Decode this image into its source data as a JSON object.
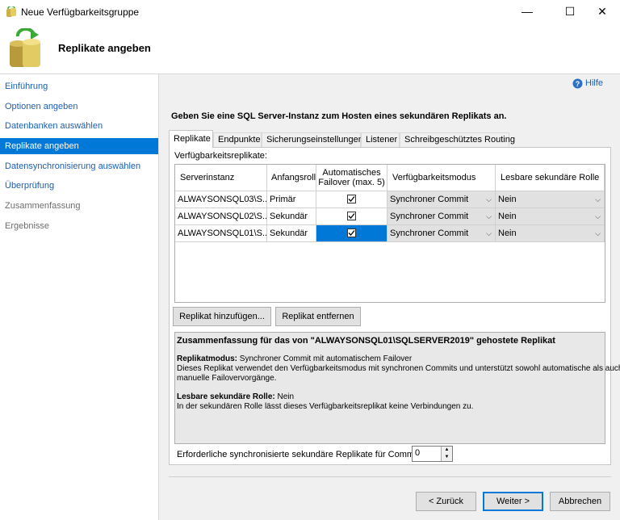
{
  "window": {
    "title": "Neue Verfügbarkeitsgruppe",
    "minimize": "—",
    "maximize": "☐",
    "close": "✕"
  },
  "header": {
    "title": "Replikate angeben"
  },
  "sidebar": {
    "items": [
      {
        "label": "Einführung",
        "state": "link"
      },
      {
        "label": "Optionen angeben",
        "state": "link"
      },
      {
        "label": "Datenbanken auswählen",
        "state": "link"
      },
      {
        "label": "Replikate angeben",
        "state": "active"
      },
      {
        "label": "Datensynchronisierung auswählen",
        "state": "link"
      },
      {
        "label": "Überprüfung",
        "state": "link"
      },
      {
        "label": "Zusammenfassung",
        "state": "disabled"
      },
      {
        "label": "Ergebnisse",
        "state": "disabled"
      }
    ]
  },
  "help": {
    "label": "Hilfe",
    "icon": "help-icon"
  },
  "main": {
    "instruction": "Geben Sie eine SQL Server-Instanz zum Hosten eines sekundären Replikats an.",
    "tabs": [
      "Replikate",
      "Endpunkte",
      "Sicherungseinstellungen",
      "Listener",
      "Schreibgeschütztes Routing"
    ],
    "active_tab": "Replikate",
    "group_label": "Verfügbarkeitsreplikate:",
    "columns": {
      "server": "Serverinstanz",
      "role": "Anfangsroll",
      "failover_1": "Automatisches",
      "failover_2": "Failover (max. 5)",
      "mode": "Verfügbarkeitsmodus",
      "readable": "Lesbare sekundäre Rolle"
    },
    "rows": [
      {
        "server": "ALWAYSONSQL03\\S...",
        "role": "Primär",
        "failover": true,
        "mode": "Synchroner Commit",
        "readable": "Nein"
      },
      {
        "server": "ALWAYSONSQL02\\S...",
        "role": "Sekundär",
        "failover": true,
        "mode": "Synchroner Commit",
        "readable": "Nein"
      },
      {
        "server": "ALWAYSONSQL01\\S...",
        "role": "Sekundär",
        "failover": true,
        "mode": "Synchroner Commit",
        "readable": "Nein"
      }
    ],
    "add_button": "Replikat hinzufügen...",
    "remove_button": "Replikat entfernen",
    "summary": {
      "title": "Zusammenfassung für das von \"ALWAYSONSQL01\\SQLSERVER2019\" gehostete Replikat",
      "mode_label": "Replikatmodus:",
      "mode_value": " Synchroner Commit mit automatischem Failover",
      "mode_desc_1": "Dieses Replikat verwendet den Verfügbarkeitsmodus mit synchronen Commits und unterstützt sowohl automatische als auch",
      "mode_desc_2": "manuelle Failovervorgänge.",
      "readable_label": "Lesbare sekundäre Rolle:",
      "readable_value": " Nein",
      "readable_desc": "In der sekundären Rolle lässt dieses Verfügbarkeitsreplikat keine Verbindungen zu."
    },
    "commit_label": "Erforderliche synchronisierte sekundäre Replikate für Commit",
    "commit_value": "0"
  },
  "footer": {
    "back": "< Zurück",
    "next": "Weiter >",
    "cancel": "Abbrechen"
  },
  "colors": {
    "accent": "#0078d7",
    "link": "#1a5fb4"
  }
}
